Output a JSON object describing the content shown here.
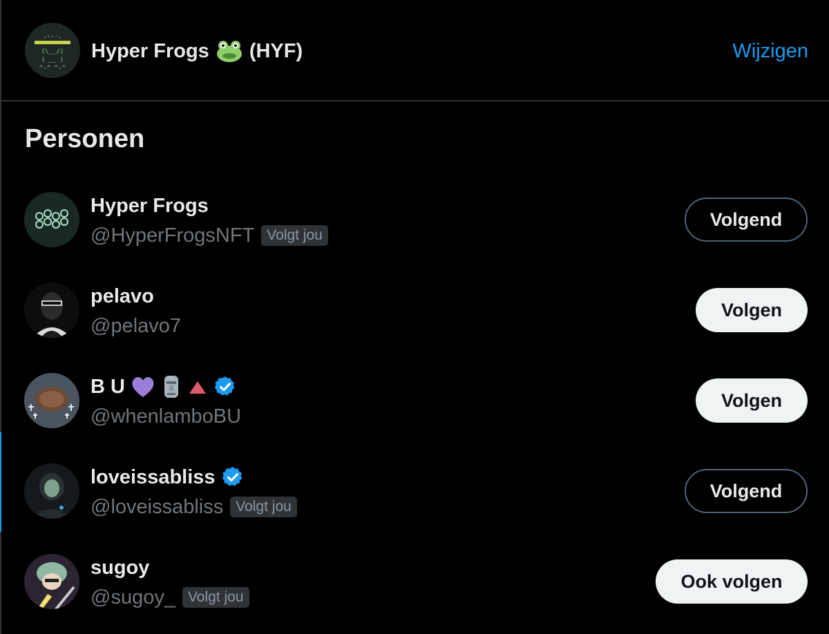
{
  "header": {
    "title": "Hyper Frogs",
    "title_suffix": "(HYF)",
    "title_icon": "frog-icon",
    "action_label": "Wijzigen"
  },
  "section": {
    "title": "Personen"
  },
  "people": [
    {
      "name": "Hyper Frogs",
      "handle": "@HyperFrogsNFT",
      "follows_you": "Volgt jou",
      "button": "Volgend",
      "verified": false
    },
    {
      "name": "pelavo",
      "handle": "@pelavo7",
      "button": "Volgen",
      "verified": false
    },
    {
      "name": "B U",
      "name_icons": [
        "purple-heart-icon",
        "moai-icon",
        "red-triangle-icon",
        "verified-badge-icon"
      ],
      "handle": "@whenlamboBU",
      "button": "Volgen",
      "verified": true
    },
    {
      "name": "loveissabliss",
      "handle": "@loveissabliss",
      "follows_you": "Volgt jou",
      "button": "Volgend",
      "verified": true
    },
    {
      "name": "sugoy",
      "handle": "@sugoy_",
      "follows_you": "Volgt jou",
      "button": "Ook volgen",
      "verified": false
    }
  ],
  "colors": {
    "background": "#000000",
    "primary_text": "#e7e9ea",
    "secondary_text": "#71767b",
    "accent": "#1d9bf0",
    "divider": "#2f3336"
  }
}
